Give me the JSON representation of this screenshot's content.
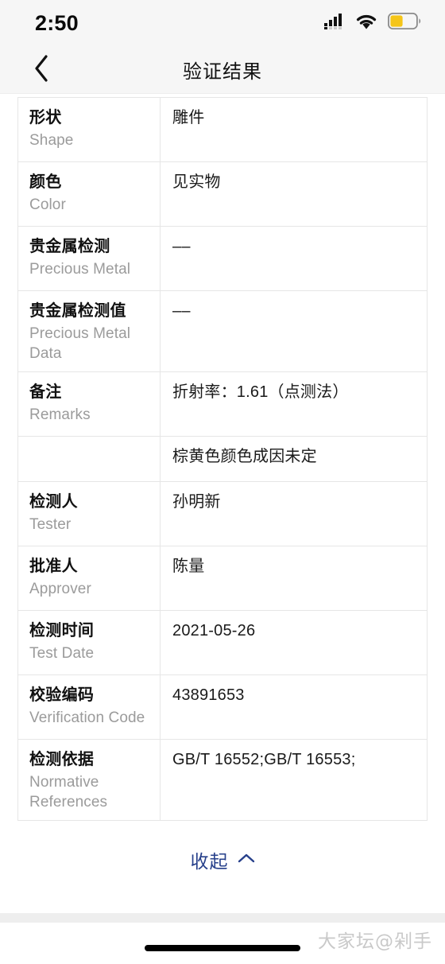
{
  "status_bar": {
    "time": "2:50",
    "signal_icon": "cellular-signal-icon",
    "wifi_icon": "wifi-icon",
    "battery_icon": "battery-icon",
    "battery_level_percent": 45,
    "battery_color": "#f5c518"
  },
  "header": {
    "back_icon": "chevron-left-icon",
    "title": "验证结果"
  },
  "table": {
    "rows": [
      {
        "label_cn": "形状",
        "label_en": "Shape",
        "value": "雕件"
      },
      {
        "label_cn": "颜色",
        "label_en": "Color",
        "value": "见实物"
      },
      {
        "label_cn": "贵金属检测",
        "label_en": "Precious Metal",
        "value": "––"
      },
      {
        "label_cn": "贵金属检测值",
        "label_en": "Precious Metal Data",
        "value": "––"
      },
      {
        "label_cn": "备注",
        "label_en": "Remarks",
        "value": "折射率：1.61（点测法）"
      },
      {
        "label_cn": "",
        "label_en": "",
        "value": "棕黄色颜色成因未定",
        "short": true
      },
      {
        "label_cn": "检测人",
        "label_en": "Tester",
        "value": "孙明新"
      },
      {
        "label_cn": "批准人",
        "label_en": "Approver",
        "value": "陈量"
      },
      {
        "label_cn": "检测时间",
        "label_en": "Test Date",
        "value": "2021-05-26"
      },
      {
        "label_cn": "校验编码",
        "label_en": "Verification Code",
        "value": "43891653"
      },
      {
        "label_cn": "检测依据",
        "label_en": "Normative References",
        "value": "GB/T 16552;GB/T 16553;"
      }
    ]
  },
  "collapse": {
    "label": "收起",
    "icon": "chevron-up-icon",
    "color": "#27408b"
  },
  "footer": {
    "watermark": "大家坛@剁手",
    "home_indicator": "home-indicator"
  }
}
